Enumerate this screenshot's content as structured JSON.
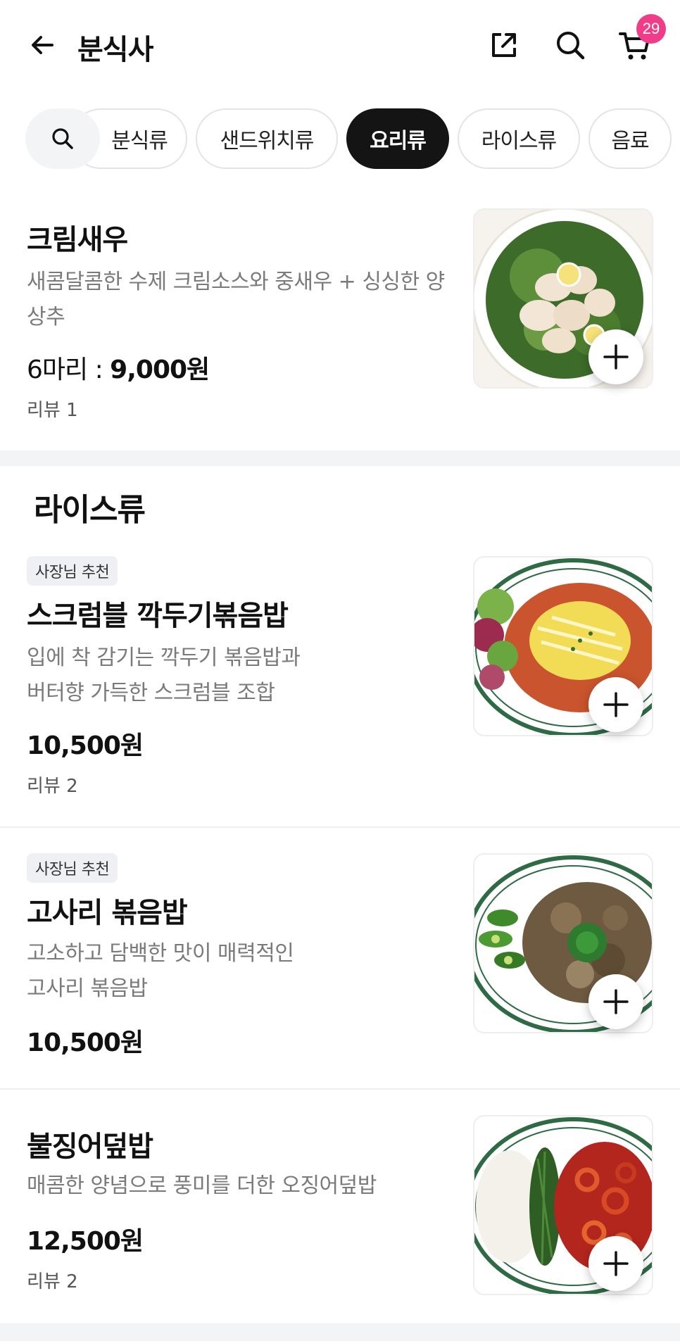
{
  "header": {
    "title": "분식사",
    "cart_count": "29"
  },
  "categories": {
    "items": [
      {
        "label": "분식류",
        "active": false
      },
      {
        "label": "샌드위치류",
        "active": false
      },
      {
        "label": "요리류",
        "active": true
      },
      {
        "label": "라이스류",
        "active": false
      },
      {
        "label": "음료",
        "active": false
      }
    ]
  },
  "menu": {
    "cream_shrimp": {
      "name": "크림새우",
      "desc": "새콤달콤한 수제 크림소스와 중새우 + 싱싱한 양상추",
      "price_prefix": "6마리 : ",
      "price": "9,000원",
      "review": "리뷰 1"
    },
    "section_title": "라이스류",
    "scramble": {
      "tag": "사장님 추천",
      "name": "스크럼블 깍두기볶음밥",
      "desc_line1": "입에 착 감기는 깍두기 볶음밥과",
      "desc_line2": "버터향 가득한 스크럼블 조합",
      "price": "10,500원",
      "review": "리뷰 2"
    },
    "gosari": {
      "tag": "사장님 추천",
      "name": "고사리 볶음밥",
      "desc_line1": "고소하고 담백한 맛이 매력적인",
      "desc_line2": "고사리 볶음밥",
      "price": "10,500원"
    },
    "squid": {
      "name": "불징어덮밥",
      "desc": "매콤한 양념으로 풍미를 더한 오징어덮밥",
      "price": "12,500원",
      "review": "리뷰 2"
    }
  },
  "colors": {
    "badge": "#f03d8a",
    "active_chip": "#141414",
    "chip_border": "#e3e4e7",
    "divider": "#f3f4f6"
  },
  "icons": [
    "back-arrow-icon",
    "share-icon",
    "search-icon",
    "cart-icon",
    "plus-icon"
  ]
}
